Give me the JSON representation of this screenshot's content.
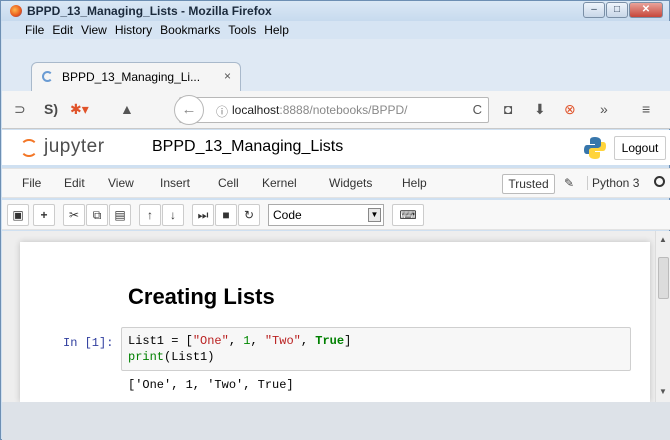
{
  "window": {
    "title": "BPPD_13_Managing_Lists - Mozilla Firefox",
    "min_label": "–",
    "max_label": "□",
    "close_label": "✕"
  },
  "menubar": {
    "items": [
      {
        "label": "File"
      },
      {
        "label": "Edit"
      },
      {
        "label": "View"
      },
      {
        "label": "History"
      },
      {
        "label": "Bookmarks"
      },
      {
        "label": "Tools"
      },
      {
        "label": "Help"
      }
    ]
  },
  "tab": {
    "label": "BPPD_13_Managing_Li...",
    "close": "×"
  },
  "navbar": {
    "url_host": "localhost",
    "url_rest": ":8888/notebooks/BPPD/",
    "info": "ⓘ",
    "reload": "C"
  },
  "jupyter": {
    "logo_text": "jupyter",
    "notebook_name": "BPPD_13_Managing_Lists",
    "logout_label": "Logout",
    "menu": [
      {
        "label": "File"
      },
      {
        "label": "Edit"
      },
      {
        "label": "View"
      },
      {
        "label": "Insert"
      },
      {
        "label": "Cell"
      },
      {
        "label": "Kernel"
      },
      {
        "label": "Widgets"
      },
      {
        "label": "Help"
      }
    ],
    "trusted_label": "Trusted",
    "kernel_name": "Python 3",
    "cell_type": "Code"
  },
  "notebook": {
    "heading": "Creating Lists",
    "prompt": "In [1]:",
    "code": {
      "line1_var": "List1 = [",
      "line1_s1": "\"One\"",
      "line1_sep1": ", ",
      "line1_n1": "1",
      "line1_sep2": ", ",
      "line1_s2": "\"Two\"",
      "line1_sep3": ", ",
      "line1_kw": "True",
      "line1_end": "]",
      "line2_fn": "print",
      "line2_rest": "(List1)"
    },
    "output": "['One', 1, 'Two', True]"
  },
  "colors": {
    "accent_orange": "#f37626",
    "prompt_blue": "#303f9f",
    "string_red": "#ba2121",
    "keyword_green": "#008000"
  }
}
